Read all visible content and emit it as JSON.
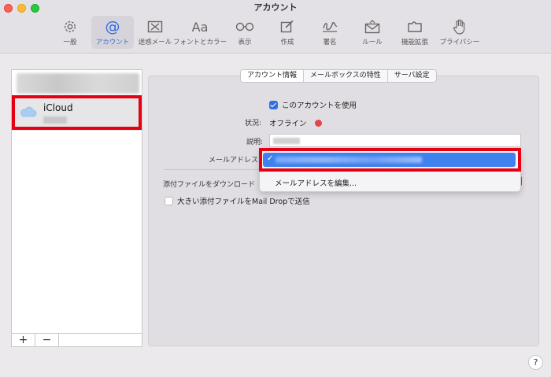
{
  "window": {
    "title": "アカウント"
  },
  "toolbar": {
    "items": [
      {
        "label": "一般",
        "icon": "gear-icon"
      },
      {
        "label": "アカウント",
        "icon": "at-icon"
      },
      {
        "label": "迷惑メール",
        "icon": "junk-tray-icon"
      },
      {
        "label": "フォントとカラー",
        "icon": "font-icon",
        "glyph": "Aa"
      },
      {
        "label": "表示",
        "icon": "glasses-icon"
      },
      {
        "label": "作成",
        "icon": "compose-icon"
      },
      {
        "label": "署名",
        "icon": "signature-icon"
      },
      {
        "label": "ルール",
        "icon": "rules-envelope-icon"
      },
      {
        "label": "機能拡張",
        "icon": "puzzle-icon"
      },
      {
        "label": "プライバシー",
        "icon": "hand-icon"
      }
    ],
    "active_index": 1
  },
  "sidebar": {
    "account_name": "iCloud",
    "add_label": "+",
    "remove_label": "−"
  },
  "tabs": [
    "アカウント情報",
    "メールボックスの特性",
    "サーバ設定"
  ],
  "form": {
    "enable_label": "このアカウントを使用",
    "enable_checked": true,
    "status_label": "状況:",
    "status_value": "オフライン",
    "status_color": "#e64545",
    "description_label": "説明:",
    "mail_address_label": "メールアドレス",
    "attachments_label": "添付ファイルをダウンロード",
    "maildrop_label": "大きい添付ファイルをMail Dropで送信",
    "maildrop_checked": false
  },
  "menu": {
    "selected_check": "✓",
    "edit_label": "メールアドレスを編集..."
  },
  "help": {
    "label": "?"
  },
  "colors": {
    "accent": "#2f6fde",
    "highlight": "#e60012"
  }
}
